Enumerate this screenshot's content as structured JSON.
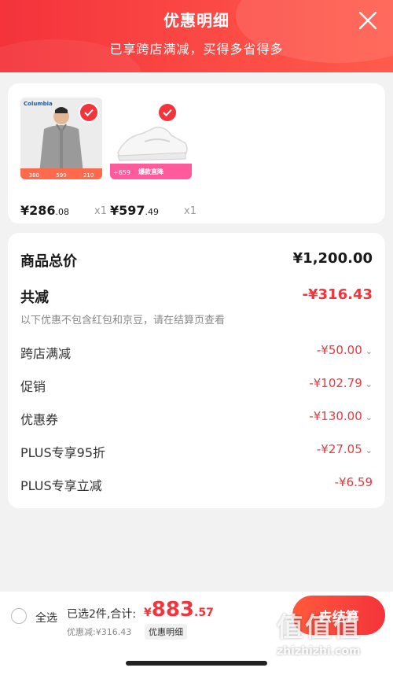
{
  "header": {
    "title": "优惠明细",
    "subtitle": "已享跨店满减，买得多省得多"
  },
  "products": [
    {
      "brand": "Columbia",
      "size_tags": [
        "380",
        "599",
        "210"
      ],
      "price_int": "¥286",
      "price_dec": ".08",
      "qty": "x1"
    },
    {
      "promo_tag": "爆款直降",
      "promo_num": "+659",
      "price_int": "¥597",
      "price_dec": ".49",
      "qty": "x1"
    }
  ],
  "breakdown": {
    "total_label": "商品总价",
    "total_value": "¥1,200.00",
    "reduce_label": "共减",
    "reduce_value": "-¥316.43",
    "note": "以下优惠不包含红包和京豆，请在结算页查看",
    "items": [
      {
        "label": "跨店满减",
        "value": "-¥50.00"
      },
      {
        "label": "促销",
        "value": "-¥102.79"
      },
      {
        "label": "优惠券",
        "value": "-¥130.00"
      },
      {
        "label": "PLUS专享95折",
        "value": "-¥27.05"
      },
      {
        "label": "PLUS专享立减",
        "value": "-¥6.59"
      }
    ]
  },
  "bottom": {
    "select_all": "全选",
    "summary": "已选2件,合计:",
    "currency": "¥",
    "total_int": "883",
    "total_dec": ".57",
    "discount": "优惠减:¥316.43",
    "detail_link": "优惠明细",
    "checkout": "去结算"
  },
  "watermark": {
    "logo": "值值值",
    "site": "zhizhizhi.com"
  },
  "colors": {
    "accent": "#f4333b",
    "header_bg": "#f4333b",
    "page_bg": "#f2f2f2"
  }
}
